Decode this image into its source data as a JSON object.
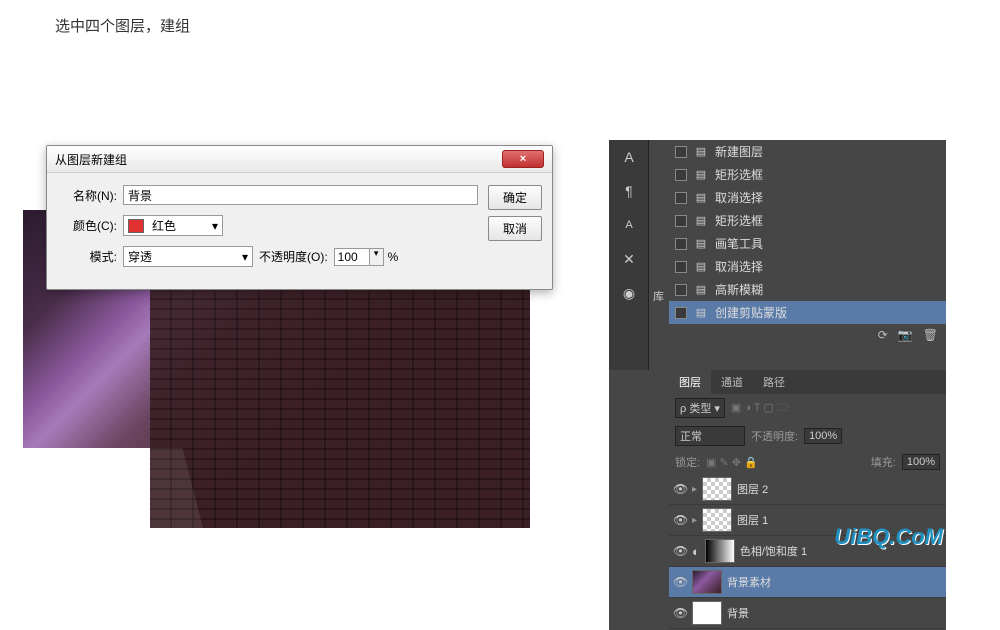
{
  "caption": "选中四个图层，建组",
  "dialog": {
    "title": "从图层新建组",
    "name_label": "名称(N):",
    "name_value": "背景",
    "color_label": "颜色(C):",
    "color_value": "红色",
    "mode_label": "模式:",
    "mode_value": "穿透",
    "opacity_label": "不透明度(O):",
    "opacity_value": "100",
    "opacity_suffix": "%",
    "ok": "确定",
    "cancel": "取消",
    "close": "×"
  },
  "tools": {
    "char": "A",
    "para": "¶",
    "char2": "A",
    "wrench": "✕",
    "cc": "◉",
    "lib": "库"
  },
  "history": {
    "items": [
      {
        "label": "新建图层"
      },
      {
        "label": "矩形选框"
      },
      {
        "label": "取消选择"
      },
      {
        "label": "矩形选框"
      },
      {
        "label": "画笔工具"
      },
      {
        "label": "取消选择"
      },
      {
        "label": "高斯模糊"
      },
      {
        "label": "创建剪贴蒙版",
        "selected": true
      }
    ]
  },
  "layers": {
    "tabs": [
      "图层",
      "通道",
      "路径"
    ],
    "kind_label": "类型",
    "blend_label": "正常",
    "opacity_label": "不透明度:",
    "opacity_val": "100%",
    "lock_label": "锁定:",
    "fill_label": "填充:",
    "fill_val": "100%",
    "items": [
      {
        "name": "图层 2",
        "type": "checker"
      },
      {
        "name": "图层 1",
        "type": "checker"
      },
      {
        "name": "色相/饱和度 1",
        "type": "adj"
      },
      {
        "name": "背景素材",
        "type": "img",
        "selected": true
      },
      {
        "name": "背景",
        "type": "white"
      }
    ]
  },
  "watermark": "UiBQ.CoM"
}
